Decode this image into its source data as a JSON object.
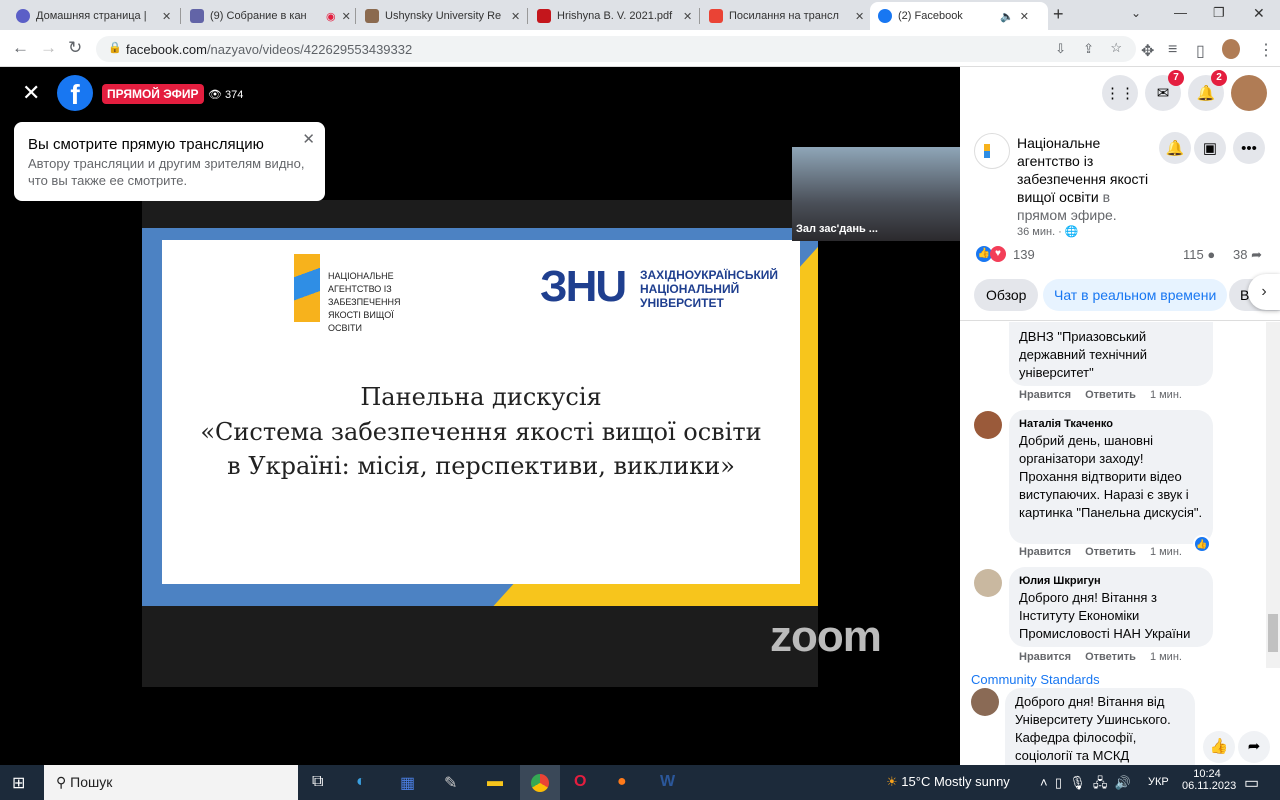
{
  "browser": {
    "tabs": [
      {
        "label": "Домашняя страница |",
        "color": "#5b5fc7"
      },
      {
        "label": "(9) Собрание в кан",
        "color": "#6264a7"
      },
      {
        "label": "Ushynsky University Re",
        "color": "#8b6a4f"
      },
      {
        "label": "Hrishyna B. V. 2021.pdf",
        "color": "#c4161c"
      },
      {
        "label": "Посилання на трансл",
        "color": "#ea4335"
      },
      {
        "label": "(2) Facebook",
        "color": "#1877f2"
      }
    ],
    "url_domain": "facebook.com",
    "url_path": "/nazyavo/videos/422629553439332",
    "new_tab": "+"
  },
  "video": {
    "live_label": "ПРЯМОЙ ЭФИР",
    "viewers": "374",
    "toast": {
      "title": "Вы смотрите прямую трансляцию",
      "body": "Автору трансляции и другим зрителям видно, что вы также ее смотрите."
    },
    "thumb_label": "Зал зас'дань ...",
    "slide": {
      "naqa_logo": "НАЦІОНАЛЬНЕ АГЕНТСТВО ІЗ ЗАБЕЗПЕЧЕННЯ ЯКОСТІ ВИЩОЇ ОСВІТИ",
      "wu_logo": "ЗАХІДНОУКРАЇНСЬКИЙ НАЦІОНАЛЬНИЙ УНІВЕРСИТЕТ",
      "line1": "Панельна дискусія",
      "line2": "«Система забезпечення якості вищої освіти",
      "line3": "в Україні: місія, перспективи, виклики»"
    },
    "zoom_watermark": "zoom"
  },
  "header": {
    "messenger_count": "7",
    "notif_count": "2"
  },
  "post": {
    "author": "Національне агентство із забезпечення якості вищої освіти",
    "suffix": "в прямом эфире.",
    "time": "36 мин. ·",
    "reactions": "139",
    "comments": "115",
    "shares": "38",
    "tabs": [
      "Обзор",
      "Чат в реальном времени",
      "В"
    ]
  },
  "comments": [
    {
      "text": "ДВНЗ \"Приазовський державний технічний університет\"",
      "like": "Нравится",
      "reply": "Ответить",
      "time": "1 мин."
    },
    {
      "name": "Наталія Ткаченко",
      "text": "Добрий день, шановні організатори заходу! Прохання відтворити відео виступаючих. Наразі є звук і картинка \"Панельна дискусія\".",
      "like": "Нравится",
      "reply": "Ответить",
      "time": "1 мин."
    },
    {
      "name": "Юлия Шкригун",
      "text": "Доброго дня! Вітання з Інституту Економіки Промисловості НАН України",
      "like": "Нравится",
      "reply": "Ответить",
      "time": "1 мин."
    }
  ],
  "community_standards": "Community Standards",
  "composer": {
    "value": "Доброго дня! Вітання від Університету Ушинського. Кафедра філософії, соціології та МСКД"
  },
  "taskbar": {
    "search": "Пошук",
    "weather": "15°C  Mostly sunny",
    "lang": "УКР",
    "time": "10:24",
    "date": "06.11.2023"
  }
}
